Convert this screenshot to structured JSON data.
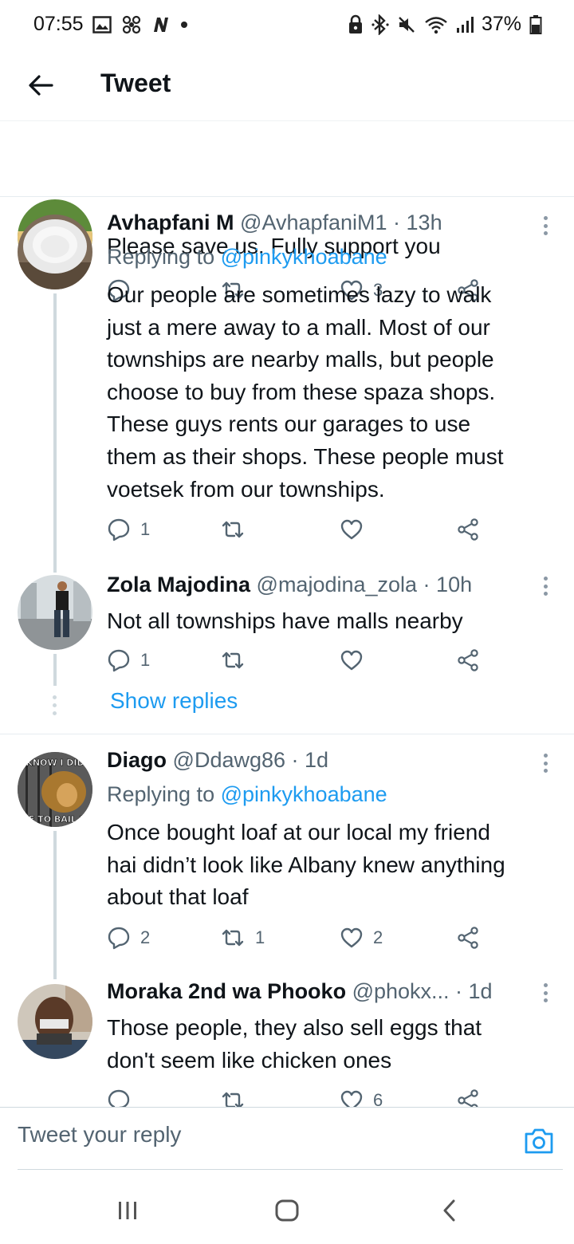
{
  "status_bar": {
    "time": "07:55",
    "battery": "37%",
    "left_icons": [
      "gallery-icon",
      "fan-icon",
      "n-app-icon",
      "dot-icon"
    ],
    "right_icons": [
      "lock-icon",
      "bluetooth-icon",
      "mute-icon",
      "wifi-icon",
      "signal-icon",
      "battery-icon"
    ]
  },
  "header": {
    "title": "Tweet"
  },
  "tweets": [
    {
      "text": "Please save us. Fully support you",
      "counts": {
        "reply": "",
        "retweet": "",
        "like": "3"
      }
    },
    {
      "name": "Avhapfani M",
      "meta": "@AvhapfaniM1 · 13h",
      "replying_prefix": "Replying to ",
      "replying_to": "@pinkykhoabane",
      "lines": [
        "Our people are sometimes lazy to walk",
        "just a mere away to a mall. Most of our",
        "townships are nearby malls, but people",
        "choose to buy from these spaza shops.",
        "These guys rents our garages to use",
        "them as their shops. These people must",
        "voetsek from our townships."
      ],
      "counts": {
        "reply": "1",
        "retweet": "",
        "like": ""
      }
    },
    {
      "name": "Zola Majodina",
      "meta": "@majodina_zola · 10h",
      "lines": [
        "Not all townships have malls nearby"
      ],
      "counts": {
        "reply": "1",
        "retweet": "",
        "like": ""
      }
    },
    {
      "name": "Diago",
      "meta": "@Ddawg86 · 1d",
      "replying_prefix": "Replying to ",
      "replying_to": "@pinkykhoabane",
      "lines": [
        "Once bought loaf at our local my friend",
        "hai didn’t look like Albany knew anything",
        "about that loaf"
      ],
      "counts": {
        "reply": "2",
        "retweet": "1",
        "like": "2"
      },
      "avatar_text_top": "KNOW I DID",
      "avatar_text_bottom": "VE TO BAIL M"
    },
    {
      "name": "Moraka 2nd wa Phooko",
      "meta": "@phokx... · 1d",
      "lines": [
        "Those people, they also sell  eggs that",
        "don't seem like chicken ones"
      ],
      "counts": {
        "reply": "",
        "retweet": "",
        "like": "6"
      }
    }
  ],
  "show_replies": "Show replies",
  "reply_box": {
    "placeholder": "Tweet your reply"
  },
  "nav": {
    "buttons": [
      "recents-button",
      "home-button",
      "back-button"
    ]
  }
}
